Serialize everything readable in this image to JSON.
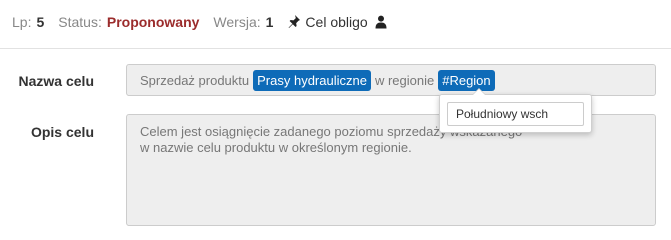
{
  "header": {
    "lp_label": "Lp:",
    "lp_value": "5",
    "status_label": "Status:",
    "status_value": "Proponowany",
    "version_label": "Wersja:",
    "version_value": "1",
    "goal_label": "Cel obligo",
    "pin_icon": "pin-icon",
    "user_icon": "user-icon"
  },
  "form": {
    "name_label": "Nazwa celu",
    "name_parts": {
      "text_before": "Sprzedaż produktu",
      "tag_product": "Prasy hydrauliczne",
      "text_middle": "w regionie",
      "tag_region": "#Region"
    },
    "description_label": "Opis celu",
    "description_lines": [
      "Celem jest osiągnięcie zadanego poziomu sprzedaży wskazanego",
      "w nazwie celu produktu w określonym regionie."
    ]
  },
  "popover": {
    "input_value": "Południowy wsch"
  },
  "colors": {
    "tag_background": "#0e6bb8",
    "status_text": "#9b2c2c"
  }
}
